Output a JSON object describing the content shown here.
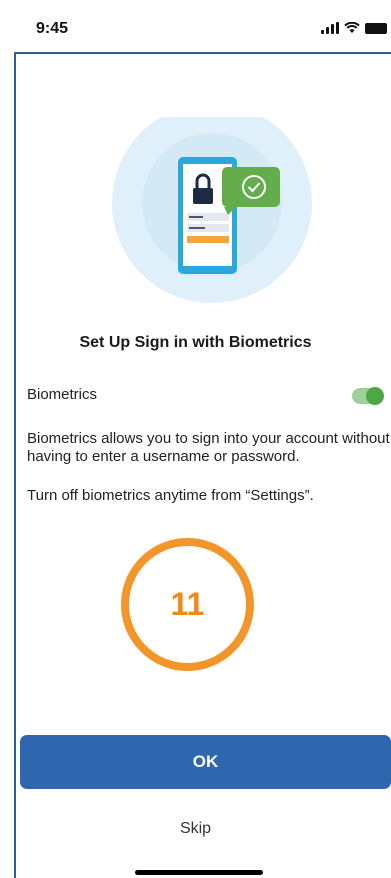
{
  "status_bar": {
    "time": "9:45",
    "icons": [
      "cellular-signal-icon",
      "wifi-icon",
      "battery-icon"
    ]
  },
  "hero": {
    "icons": [
      "lock-icon",
      "check-icon"
    ],
    "colors": {
      "halo": "#e0f0fb",
      "ring": "#d3e9f6",
      "phone": "#29a8dd",
      "check_bubble": "#64ad4c",
      "login_button": "#f2a73d"
    }
  },
  "title": "Set Up Sign in with Biometrics",
  "biometrics": {
    "label": "Biometrics",
    "enabled": true
  },
  "description": "Biometrics allows you to sign into your account without having to enter a username or password.",
  "settings_note": "Turn off biometrics anytime from “Settings”.",
  "badge": {
    "number": "11",
    "color": "#f2962a"
  },
  "actions": {
    "ok_label": "OK",
    "skip_label": "Skip"
  },
  "colors": {
    "primary": "#2e67ad",
    "toggle_on": "#4ca744",
    "frame": "#2f5f95"
  }
}
